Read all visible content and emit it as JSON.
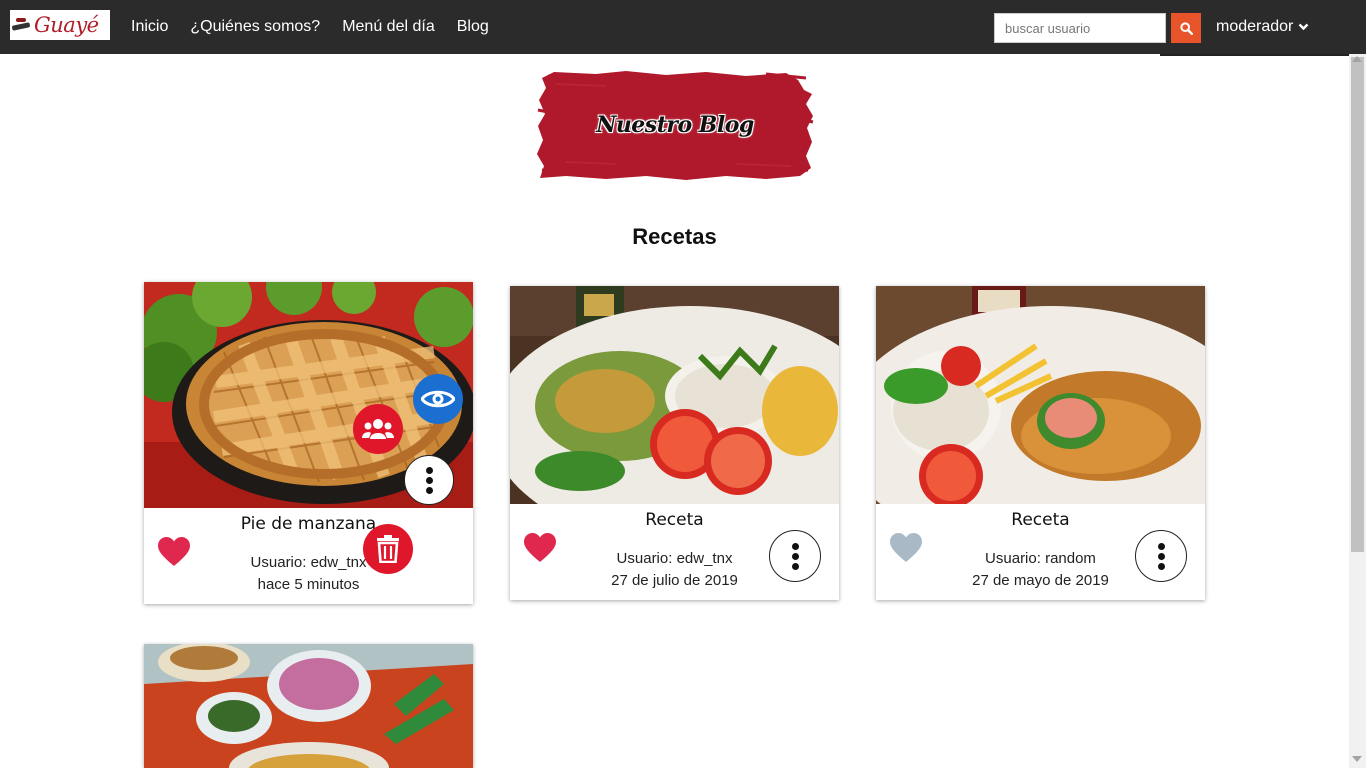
{
  "brand": {
    "logo_text": "Guayé"
  },
  "nav": {
    "links": [
      "Inicio",
      "¿Quiénes somos?",
      "Menú del día",
      "Blog"
    ],
    "search_placeholder": "buscar usuario",
    "search_icon": "search-icon",
    "user_label": "moderador",
    "user_icon": "chevron-down-icon"
  },
  "banner": {
    "title": "Nuestro Blog",
    "color": "#b0182b"
  },
  "section": {
    "title": "Recetas"
  },
  "colors": {
    "navbar": "#2b2b2b",
    "accent_orange": "#e8542a",
    "heart_liked": "#e0284f",
    "heart_unliked": "#a9bac6",
    "view_blue": "#1a6fd1",
    "action_red": "#e0162b"
  },
  "cards": [
    {
      "title": "Pie de manzana",
      "user": "Usuario: edw_tnx",
      "date": "hace 5 minutos",
      "liked": true,
      "image": "apple-pie-photo",
      "actions_open": true,
      "actions": [
        "view-icon",
        "users-icon",
        "trash-icon",
        "more-vert-icon"
      ]
    },
    {
      "title": "Receta",
      "user": "Usuario: edw_tnx",
      "date": "27 de julio de 2019",
      "liked": true,
      "image": "dish-photo-rice-tomato"
    },
    {
      "title": "Receta",
      "user": "Usuario: random",
      "date": "27 de mayo de 2019",
      "liked": false,
      "image": "dish-photo-fried-fish"
    },
    {
      "title": "",
      "image": "soup-photo"
    }
  ]
}
